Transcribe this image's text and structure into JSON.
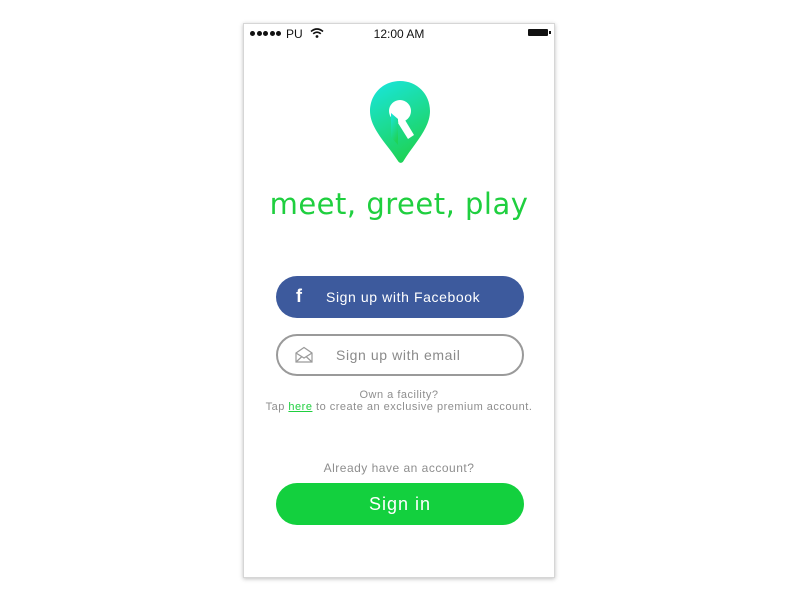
{
  "status_bar": {
    "carrier": "PU",
    "time": "12:00 AM"
  },
  "brand": {
    "tagline": "meet, greet, play",
    "accent_color": "#1fcf3f",
    "logo_icon": "map-pin-logo-icon"
  },
  "auth": {
    "facebook_label": "Sign up with Facebook",
    "facebook_icon": "facebook-icon",
    "facebook_color": "#3d5a9d",
    "email_label": "Sign up with email",
    "email_icon": "envelope-icon"
  },
  "facility": {
    "question": "Own a facility?",
    "tap_prefix": "Tap",
    "link_text": "here",
    "tap_suffix": "to create an exclusive premium account."
  },
  "signin": {
    "prompt": "Already have an account?",
    "button_label": "Sign in",
    "button_color": "#13d03e"
  }
}
